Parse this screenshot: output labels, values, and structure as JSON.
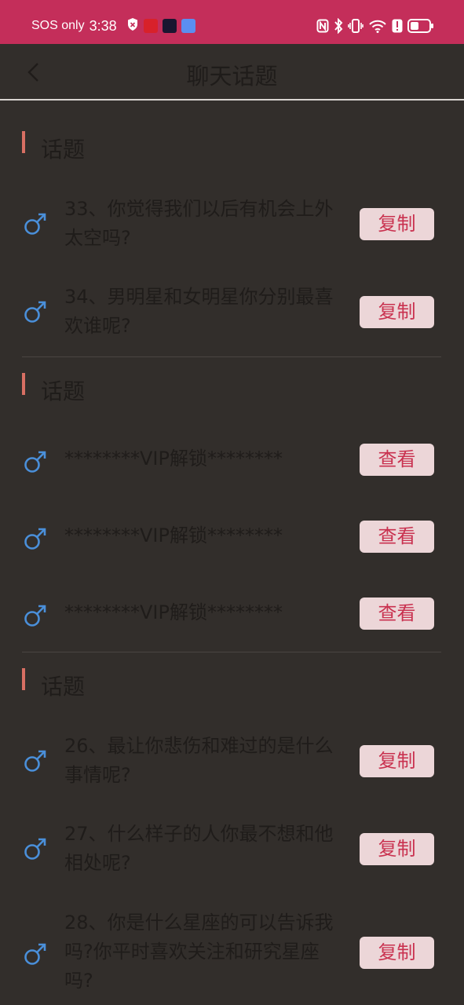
{
  "status_bar": {
    "carrier": "SOS only",
    "time": "3:38",
    "colors": {
      "background": "#c42e5a"
    },
    "icons": [
      "shield-icon",
      "app-icon-red",
      "app-icon-dark",
      "app-icon-blue",
      "nfc-icon",
      "bluetooth-icon",
      "vibrate-icon",
      "wifi-icon",
      "alert-icon",
      "battery-icon"
    ]
  },
  "app_bar": {
    "title": "聊天话题",
    "back_icon": "chevron-left-icon"
  },
  "sections": [
    {
      "title": "话题",
      "items": [
        {
          "text": "33、你觉得我们以后有机会上外太空吗?",
          "button": "复制"
        },
        {
          "text": "34、男明星和女明星你分别最喜欢谁呢?",
          "button": "复制"
        }
      ]
    },
    {
      "title": "话题",
      "items": [
        {
          "text": "********VIP解锁********",
          "button": "查看"
        },
        {
          "text": "********VIP解锁********",
          "button": "查看"
        },
        {
          "text": "********VIP解锁********",
          "button": "查看"
        }
      ]
    },
    {
      "title": "话题",
      "items": [
        {
          "text": "26、最让你悲伤和难过的是什么事情呢?",
          "button": "复制"
        },
        {
          "text": "27、什么样子的人你最不想和他相处呢?",
          "button": "复制"
        },
        {
          "text": "28、你是什么星座的可以告诉我吗?你平时喜欢关注和研究星座吗?",
          "button": "复制"
        }
      ]
    }
  ],
  "colors": {
    "page_background": "#322e2b",
    "accent_bar": "#d86f63",
    "male_icon": "#4a8fd9",
    "button_background": "#ecd6d8",
    "button_text": "#c9314f"
  }
}
